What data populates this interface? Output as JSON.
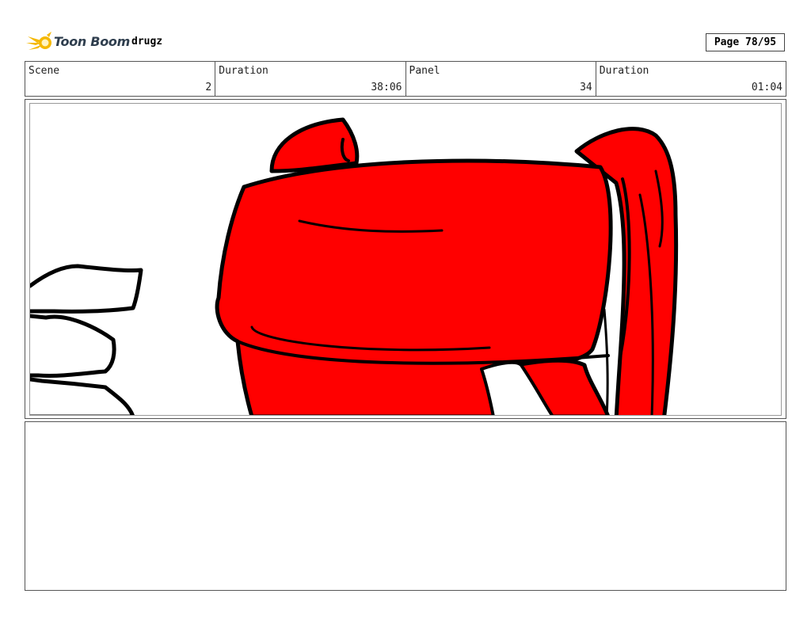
{
  "header": {
    "logo_text": "Toon Boom",
    "project_name": "drugz",
    "page_label": "Page 78/95"
  },
  "info": {
    "scene_label": "Scene",
    "scene_value": "2",
    "scene_duration_label": "Duration",
    "scene_duration_value": "38:06",
    "panel_label": "Panel",
    "panel_value": "34",
    "panel_duration_label": "Duration",
    "panel_duration_value": "01:04"
  },
  "colors": {
    "drawing_fill": "#ff0000",
    "outline": "#000000",
    "logo_accent": "#f5b800",
    "logo_text": "#2f3e4e"
  },
  "panel": {
    "drawing": "red-object-sketch"
  },
  "notes": {
    "text": ""
  }
}
